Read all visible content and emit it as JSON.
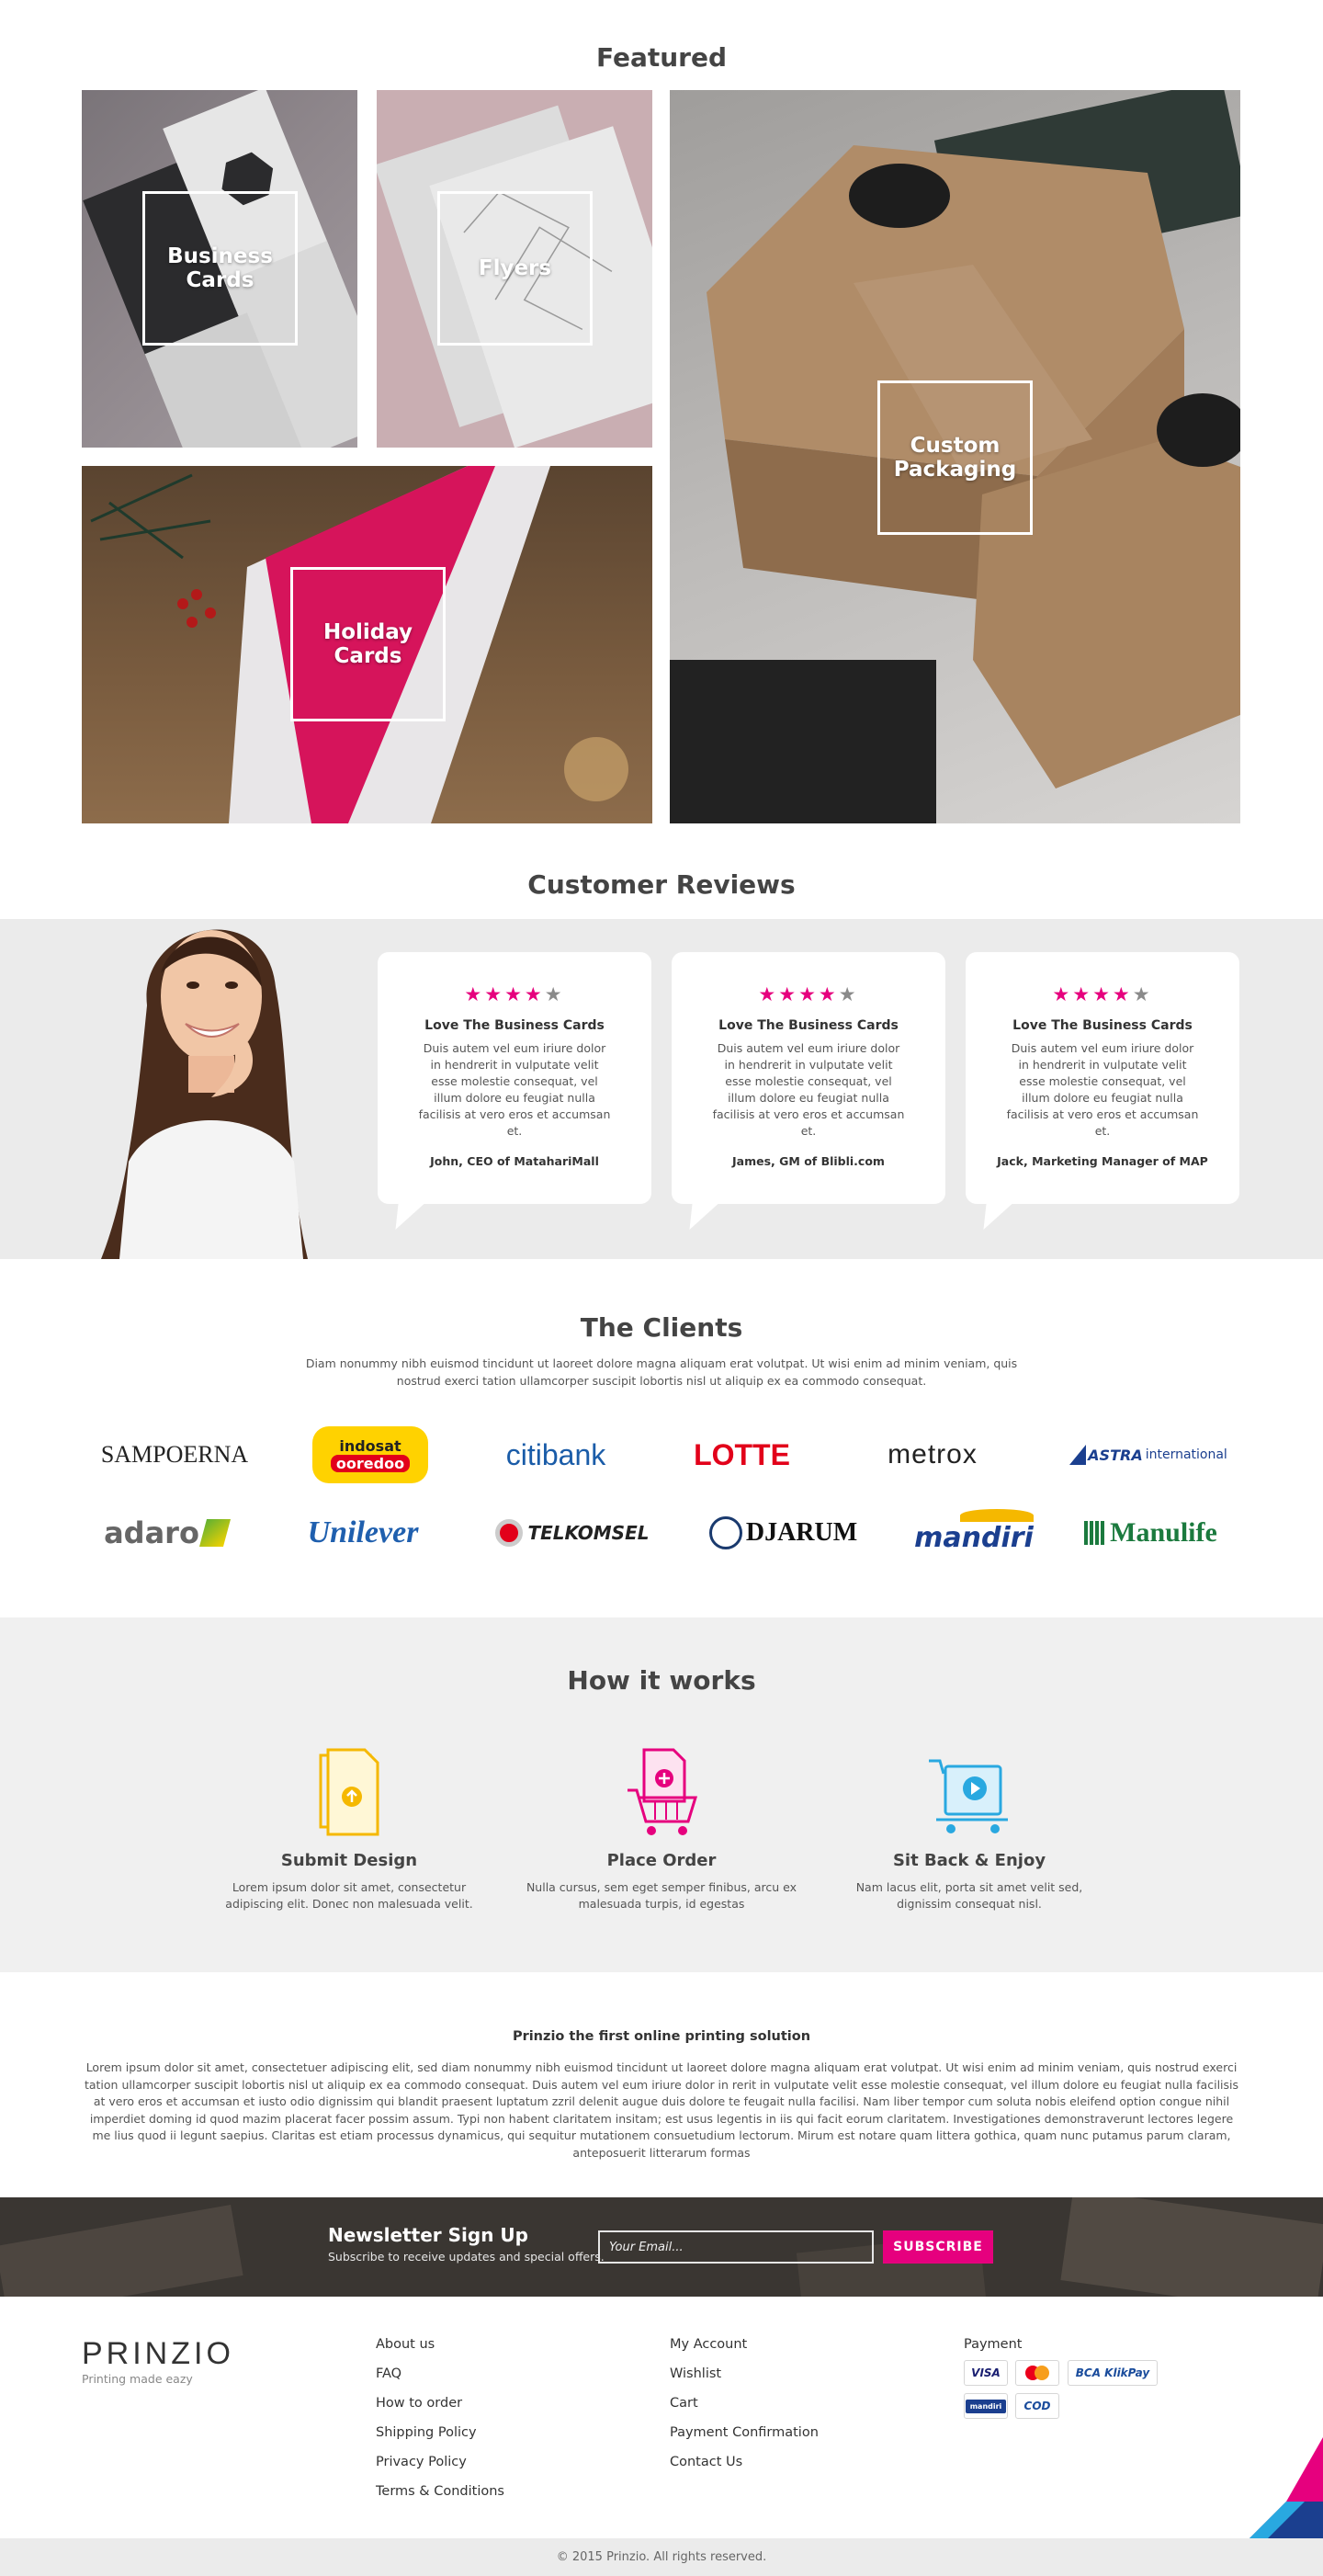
{
  "featured": {
    "title": "Featured",
    "tiles": [
      {
        "label": "Business Cards"
      },
      {
        "label": "Flyers"
      },
      {
        "label": "Custom Packaging"
      },
      {
        "label": "Holiday Cards"
      }
    ]
  },
  "reviews": {
    "title": "Customer Reviews",
    "items": [
      {
        "stars": 4,
        "title": "Love The Business Cards",
        "body": "Duis autem vel eum iriure dolor in hendrerit in vulputate velit esse molestie consequat, vel illum dolore eu feugiat nulla facilisis at vero eros et accumsan et.",
        "author": "John, CEO of MatahariMall"
      },
      {
        "stars": 4,
        "title": "Love The Business Cards",
        "body": "Duis autem vel eum iriure dolor in hendrerit in vulputate velit esse molestie consequat, vel illum dolore eu feugiat nulla facilisis at vero eros et accumsan et.",
        "author": "James, GM of Blibli.com"
      },
      {
        "stars": 4,
        "title": "Love The Business Cards",
        "body": "Duis autem vel eum iriure dolor in hendrerit in vulputate velit esse molestie consequat, vel illum dolore eu feugiat nulla facilisis at vero eros et accumsan et.",
        "author": "Jack, Marketing Manager of MAP"
      }
    ]
  },
  "clients": {
    "title": "The Clients",
    "description": "Diam nonummy nibh euismod tincidunt ut laoreet dolore magna aliquam erat volutpat. Ut wisi enim ad minim veniam, quis nostrud exerci tation ullamcorper suscipit lobortis nisl ut aliquip ex ea commodo consequat.",
    "logos": {
      "sampoerna": "SAMPOERNA",
      "indosat_top": "indosat",
      "indosat_bottom": "ooredoo",
      "citibank": "citibank",
      "lotte": "LOTTE",
      "metrox": "metrox",
      "astra_main": "ASTRA",
      "astra_sub": "international",
      "adaro": "adaro",
      "unilever": "Unilever",
      "telkomsel": "TELKOMSEL",
      "djarum": "DJARUM",
      "mandiri": "mandiri",
      "manulife": "Manulife"
    }
  },
  "how": {
    "title": "How it works",
    "steps": [
      {
        "title": "Submit Design",
        "desc": "Lorem ipsum dolor sit amet, consectetur adipiscing elit. Donec non malesuada velit.",
        "icon": "document-upload-icon",
        "color": "#f5b800"
      },
      {
        "title": "Place Order",
        "desc": "Nulla cursus, sem eget semper finibus, arcu ex malesuada turpis, id egestas",
        "icon": "shopping-cart-icon",
        "color": "#e6007e"
      },
      {
        "title": "Sit Back & Enjoy",
        "desc": "Nam lacus elit, porta sit amet velit sed, dignissim consequat nisl.",
        "icon": "delivery-box-icon",
        "color": "#29a8e0"
      }
    ]
  },
  "about": {
    "title": "Prinzio the first online printing solution",
    "body": "Lorem ipsum dolor sit amet, consectetuer adipiscing elit, sed diam nonummy nibh euismod tincidunt ut laoreet dolore magna aliquam erat volutpat. Ut wisi enim ad minim veniam, quis nostrud exerci tation ullamcorper suscipit lobortis nisl ut aliquip ex ea commodo consequat. Duis autem vel eum iriure dolor in rerit in vulputate velit esse molestie consequat, vel illum dolore eu feugiat nulla facilisis at vero eros et accumsan et iusto odio dignissim qui blandit praesent luptatum zzril delenit augue duis dolore te feugait nulla facilisi. Nam liber tempor cum soluta nobis eleifend option congue nihil imperdiet doming id quod mazim placerat facer possim assum. Typi non habent claritatem insitam; est usus legentis in iis qui facit eorum claritatem. Investigationes demonstraverunt lectores legere me lius quod ii legunt saepius. Claritas est etiam processus dynamicus, qui sequitur mutationem consuetudium lectorum. Mirum est notare quam littera gothica, quam nunc putamus parum claram, anteposuerit litterarum formas"
  },
  "newsletter": {
    "title": "Newsletter Sign Up",
    "subtitle": "Subscribe to receive updates and special offers.",
    "placeholder": "Your Email...",
    "button": "SUBSCRIBE"
  },
  "footer": {
    "brand": "PRINZIO",
    "tagline": "Printing made eazy",
    "col1": [
      "About us",
      "FAQ",
      "How to order",
      "Shipping Policy",
      "Privacy Policy",
      "Terms & Conditions"
    ],
    "col2": [
      "My Account",
      "Wishlist",
      "Cart",
      "Payment Confirmation",
      "Contact Us"
    ],
    "payment_title": "Payment",
    "payments": [
      "VISA",
      "MasterCard",
      "BCA KlikPay",
      "mandiri",
      "COD"
    ],
    "copyright": "© 2015 Prinzio. All rights reserved."
  },
  "colors": {
    "accent": "#e6007e",
    "band": "#ebebeb",
    "newsletter_bg": "#3a3632"
  }
}
